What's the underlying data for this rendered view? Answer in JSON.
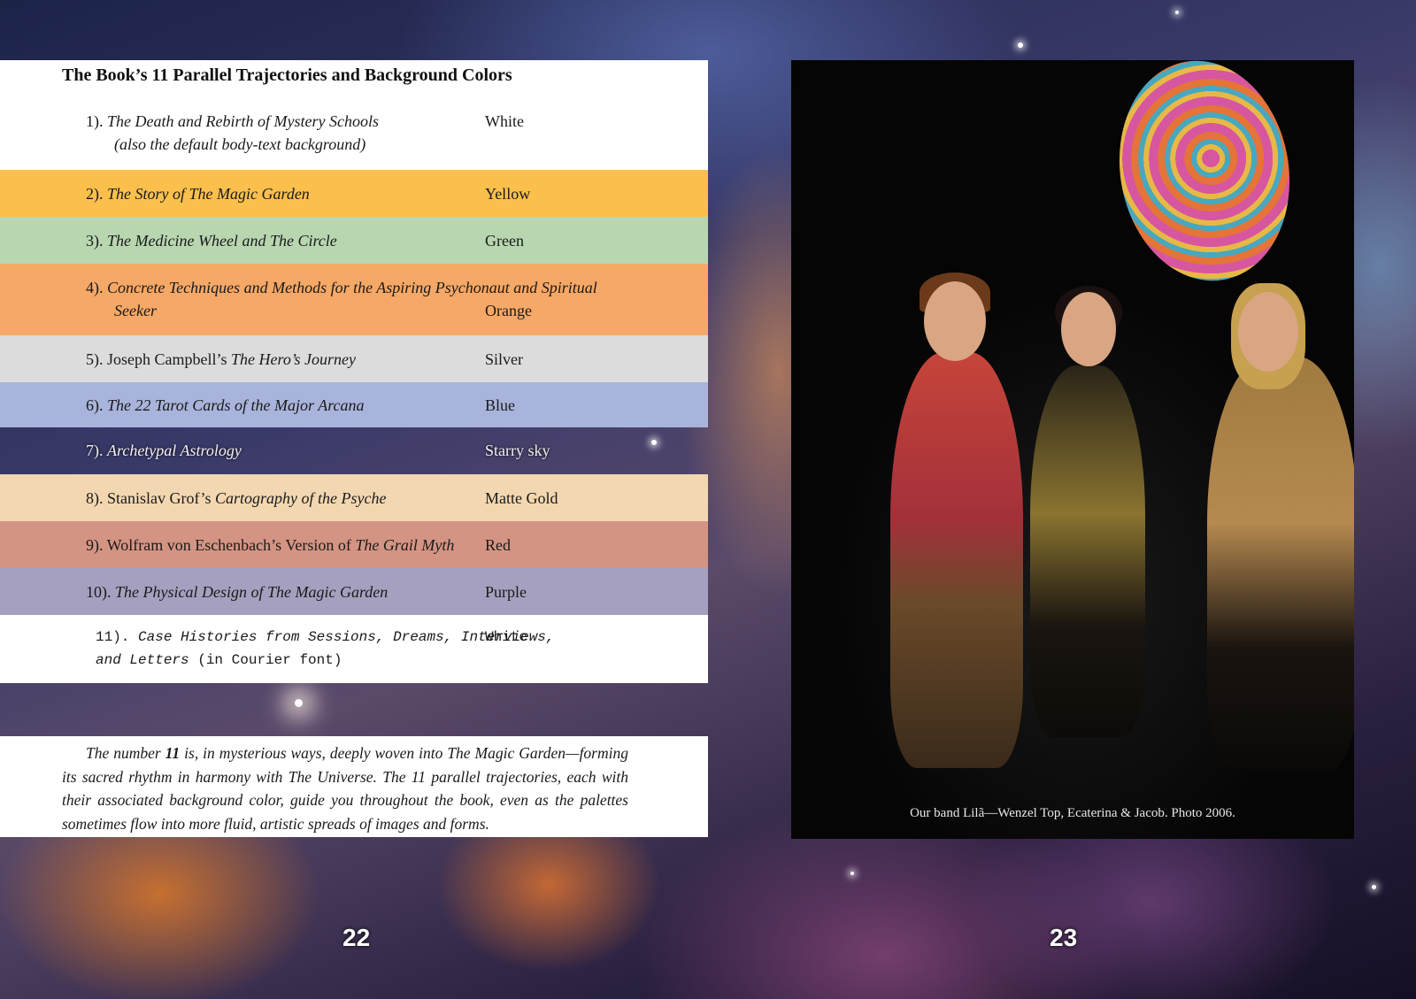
{
  "heading": "The Book’s 11 Parallel Trajectories and Background Colors",
  "rows": [
    {
      "num": "1). ",
      "title": "The Death and Rebirth of Mystery Schools",
      "sub": "(also the default body-text background)",
      "color": "White",
      "bg": "#ffffff"
    },
    {
      "num": "2). ",
      "title": "The Story of The Magic Garden",
      "color": "Yellow",
      "bg": "#fbc04c"
    },
    {
      "num": "3). ",
      "title": "The Medicine Wheel and The Circle",
      "color": "Green",
      "bg": "#b8d7b0"
    },
    {
      "num": "4). ",
      "title": "Concrete Techniques and Methods for the Aspiring Psychonaut and Spiritual",
      "title2": "Seeker",
      "color": "Orange",
      "bg": "#f6a867"
    },
    {
      "num": "5).  Joseph Campbell’s ",
      "title": "The Hero’s Journey",
      "color": "Silver",
      "bg": "#dcdcdc"
    },
    {
      "num": "6). ",
      "title": "The 22 Tarot Cards of the Major Arcana",
      "color": "Blue",
      "bg": "#a9b4dc"
    },
    {
      "num": "7). ",
      "title": "Archetypal Astrology",
      "color": "Starry sky",
      "bg": "transparent"
    },
    {
      "num": "8). Stanislav Grof’s ",
      "title": "Cartography of the Psyche",
      "color": "Matte Gold",
      "bg": "#f3d7b0"
    },
    {
      "num": "9). Wolfram von Eschenbach’s Version of ",
      "title": "The Grail Myth",
      "color": "Red",
      "bg": "#d49483"
    },
    {
      "num": "10). ",
      "title": "The Physical Design of The Magic Garden",
      "color": "Purple",
      "bg": "#a5a0bf"
    },
    {
      "num": "11). ",
      "title": "Case Histories from Sessions, Dreams, Interviews,",
      "title2": "and Letters",
      "suffix": " (in Courier font)",
      "color": "White",
      "bg": "#ffffff"
    }
  ],
  "paragraph": {
    "pre": "The number ",
    "bold": "11",
    "post": " is, in mysterious ways, deeply woven into The Magic Garden—forming its sacred rhythm in harmony with The Universe. The 11 parallel trajectories, each with their associated background color, guide you throughout the book, even as the palettes sometimes flow into more fluid, artistic spreads of images and forms."
  },
  "page_left": "22",
  "page_right": "23",
  "photo_caption": "Our band Lilã—Wenzel Top, Ecaterina & Jacob. Photo 2006."
}
